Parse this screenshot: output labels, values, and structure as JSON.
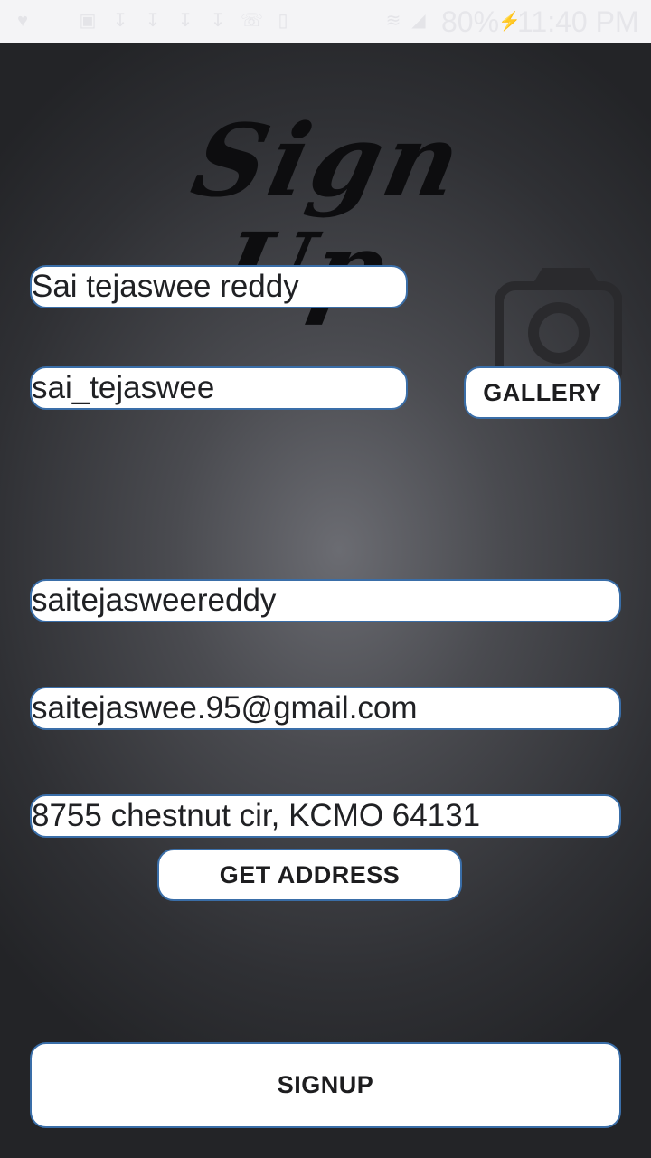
{
  "status_bar": {
    "battery": "80%",
    "time": "11:40 PM",
    "icons": [
      "heart-icon",
      "image-icon",
      "download-icon",
      "download-icon",
      "download-icon",
      "download-icon",
      "phone-icon",
      "sim-icon",
      "wifi-icon",
      "signal-icon",
      "charging-icon"
    ]
  },
  "page": {
    "title": "Sign Up"
  },
  "form": {
    "full_name": "Sai tejaswee reddy",
    "username": "sai_tejaswee",
    "password": "saitejasweereddy",
    "email": "saitejaswee.95@gmail.com",
    "address": "8755 chestnut cir, KCMO 64131"
  },
  "buttons": {
    "gallery": "GALLERY",
    "get_address": "GET ADDRESS",
    "signup": "SIGNUP"
  },
  "colors": {
    "field_border": "#3a6ea8",
    "field_bg": "#ffffff",
    "bg_center": "#6b6c72",
    "bg_edge": "#232427"
  }
}
